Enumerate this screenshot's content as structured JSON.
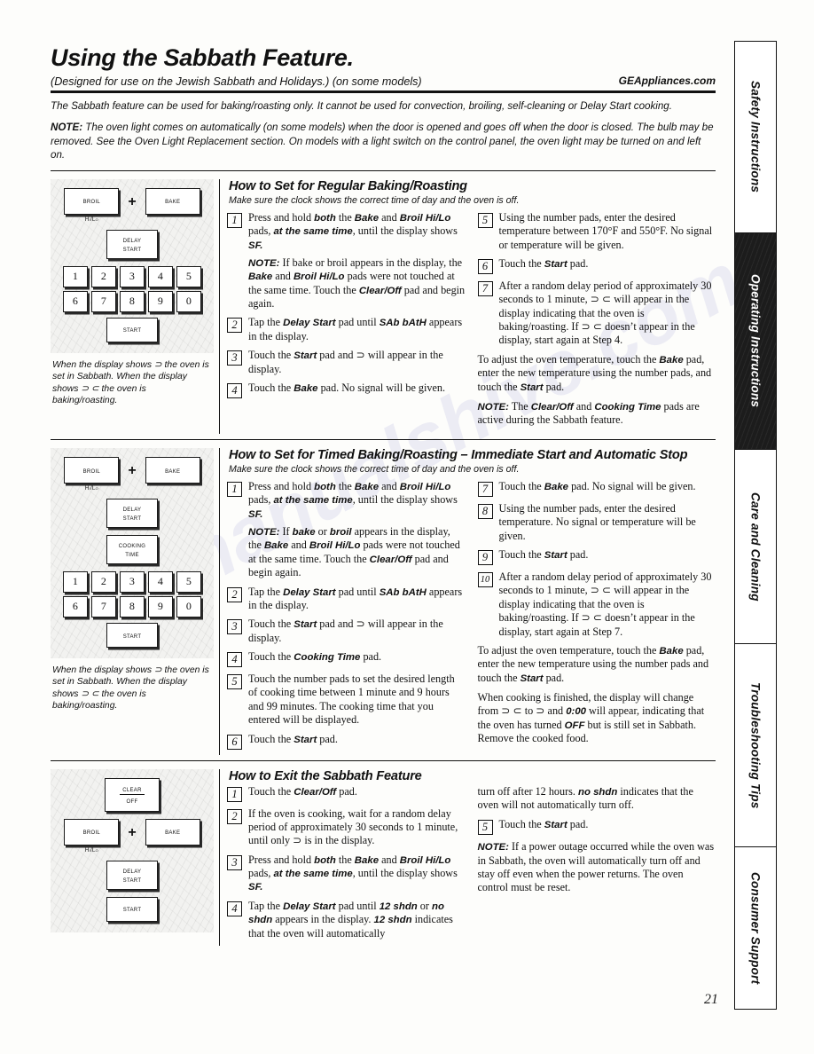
{
  "header": {
    "title": "Using the Sabbath Feature.",
    "subtitle": "(Designed for use on the Jewish Sabbath and Holidays.) (on some models)",
    "brand_url": "GEAppliances.com"
  },
  "intro": {
    "paragraph": "The Sabbath feature can be used for baking/roasting only. It cannot be used for convection, broiling, self-cleaning or Delay Start cooking.",
    "note_label": "NOTE:",
    "note_text": " The oven light comes on automatically (on some models) when the door is opened and goes off when the door is closed. The bulb may be removed. See the Oven Light Replacement section. On models with a light switch on the control panel, the oven light may be turned on and left on."
  },
  "panel_caption": "When the display shows ⊃ the oven is set in Sabbath. When the display shows ⊃ ⊂ the oven is baking/roasting.",
  "keys": {
    "broil": "Broil",
    "bake": "Bake",
    "hilo": "Hi/Lo",
    "delay_start_l1": "Delay",
    "delay_start_l2": "Start",
    "cooking_time_l1": "Cooking",
    "cooking_time_l2": "Time",
    "start": "Start",
    "clear_l1": "Clear",
    "clear_l2": "Off",
    "plus": "+",
    "numbers_row1": [
      "1",
      "2",
      "3",
      "4",
      "5"
    ],
    "numbers_row2": [
      "6",
      "7",
      "8",
      "9",
      "0"
    ]
  },
  "sections": [
    {
      "heading": "How to Set for Regular Baking/Roasting",
      "subheading": "Make sure the clock shows the correct time of day and the oven is off.",
      "steps_left": [
        {
          "num": "1",
          "paras": [
            "Press and hold <b class=\"sans\">both</b> the <b class=\"sans\">Bake</b> and <b class=\"sans\">Broil Hi/Lo</b> pads, <b class=\"sans\">at the same time</b>, until the display shows <b class=\"sans\">SF.</b>",
            "<b class=\"sans\">NOTE:</b> If bake or broil appears in the display, the <b class=\"sans\">Bake</b> and <b class=\"sans\">Broil Hi/Lo</b> pads were not touched at the same time. Touch the <b class=\"sans\">Clear/Off</b> pad and begin again."
          ]
        },
        {
          "num": "2",
          "paras": [
            "Tap the <b class=\"sans\">Delay Start</b> pad until <b class=\"sans\">SAb bAtH</b> appears in the display."
          ]
        },
        {
          "num": "3",
          "paras": [
            "Touch the <b class=\"sans\">Start</b> pad and ⊃ will appear in the display."
          ]
        },
        {
          "num": "4",
          "paras": [
            "Touch the <b class=\"sans\">Bake</b> pad. No signal will be given."
          ]
        }
      ],
      "steps_right": [
        {
          "num": "5",
          "paras": [
            "Using the number pads, enter the desired temperature between 170°F and 550°F. No signal or temperature will be given."
          ]
        },
        {
          "num": "6",
          "paras": [
            "Touch the <b class=\"sans\">Start</b> pad."
          ]
        },
        {
          "num": "7",
          "paras": [
            "After a random delay period of approximately 30 seconds to 1 minute, ⊃ ⊂ will appear in the display indicating that the oven is baking/roasting. If ⊃ ⊂ doesn’t appear in the display, start again at Step 4."
          ]
        }
      ],
      "closing_right": [
        "To adjust the oven temperature, touch the <b class=\"sans\">Bake</b> pad, enter the new temperature using the number pads, and touch the <b class=\"sans\">Start</b> pad.",
        "<b class=\"sans\">NOTE:</b> The <b class=\"sans\">Clear/Off</b> and <b class=\"sans\">Cooking Time</b> pads are active during the Sabbath feature."
      ]
    },
    {
      "heading": "How to Set for Timed Baking/Roasting – Immediate Start and Automatic Stop",
      "subheading": "Make sure the clock shows the correct time of day and the oven is off.",
      "steps_left": [
        {
          "num": "1",
          "paras": [
            "Press and hold <b class=\"sans\">both</b> the <b class=\"sans\">Bake</b> and <b class=\"sans\">Broil Hi/Lo</b> pads, <b class=\"sans\">at the same time</b>, until the display shows <b class=\"sans\">SF.</b>",
            "<b class=\"sans\">NOTE:</b> If <b class=\"sans\">bake</b> or <b class=\"sans\">broil</b> appears in the display, the <b class=\"sans\">Bake</b> and <b class=\"sans\">Broil Hi/Lo</b> pads were not touched at the same time. Touch the <b class=\"sans\">Clear/Off</b> pad and begin again."
          ]
        },
        {
          "num": "2",
          "paras": [
            "Tap the <b class=\"sans\">Delay Start</b> pad until <b class=\"sans\">SAb bAtH</b> appears in the display."
          ]
        },
        {
          "num": "3",
          "paras": [
            "Touch the <b class=\"sans\">Start</b> pad and ⊃ will appear in the display."
          ]
        },
        {
          "num": "4",
          "paras": [
            "Touch the <b class=\"sans\">Cooking Time</b> pad."
          ]
        },
        {
          "num": "5",
          "paras": [
            "Touch the number pads to set the desired length of cooking time between 1 minute and 9 hours and 99 minutes. The cooking time that you entered will be displayed."
          ]
        },
        {
          "num": "6",
          "paras": [
            "Touch the <b class=\"sans\">Start</b> pad."
          ]
        }
      ],
      "steps_right": [
        {
          "num": "7",
          "paras": [
            "Touch the <b class=\"sans\">Bake</b> pad. No signal will be given."
          ]
        },
        {
          "num": "8",
          "paras": [
            "Using the number pads, enter the desired temperature. No signal or temperature will be given."
          ]
        },
        {
          "num": "9",
          "paras": [
            "Touch the <b class=\"sans\">Start</b> pad."
          ]
        },
        {
          "num": "10",
          "paras": [
            "After a random delay period of approximately 30 seconds to 1 minute, ⊃ ⊂ will appear in the display indicating that the oven is baking/roasting. If ⊃ ⊂ doesn’t appear in the display, start again at Step 7."
          ]
        }
      ],
      "closing_right": [
        "To adjust the oven temperature, touch the <b class=\"sans\">Bake</b> pad, enter the new temperature using the number pads and touch the <b class=\"sans\">Start</b> pad.",
        "When cooking is finished, the display will change from ⊃ ⊂ to ⊃ and <b class=\"sans\">0:00</b> will appear, indicating that the oven has turned <b class=\"sans\">OFF</b> but is still set in Sabbath. Remove the cooked food."
      ]
    },
    {
      "heading": "How to Exit the Sabbath Feature",
      "subheading": "",
      "steps_left": [
        {
          "num": "1",
          "paras": [
            "Touch the <b class=\"sans\">Clear/Off</b> pad."
          ]
        },
        {
          "num": "2",
          "paras": [
            "If the oven is cooking, wait for a random delay period of approximately 30 seconds to 1 minute, until only ⊃ is in the display."
          ]
        },
        {
          "num": "3",
          "paras": [
            "Press and hold <b class=\"sans\">both</b> the <b class=\"sans\">Bake</b> and <b class=\"sans\">Broil Hi/Lo</b> pads, <b class=\"sans\">at the same time</b>, until the display shows <b class=\"sans\">SF.</b>"
          ]
        },
        {
          "num": "4",
          "paras": [
            "Tap the <b class=\"sans\">Delay Start</b> pad until <b class=\"sans\">12 shdn</b> or <b class=\"sans\">no shdn</b> appears in the display. <b class=\"sans\">12 shdn</b> indicates that the oven will automatically"
          ]
        }
      ],
      "steps_right": [
        {
          "num": "5",
          "paras": [
            "Touch the <b class=\"sans\">Start</b> pad."
          ]
        }
      ],
      "continuation_right": "turn off after 12 hours. <b class=\"sans\">no shdn</b> indicates that the oven will not automatically turn off.",
      "closing_right": [
        "<b class=\"sans\">NOTE:</b> If a power outage occurred while the oven was in Sabbath, the oven will automatically turn off and stay off even when the power returns. The oven control must be reset."
      ]
    }
  ],
  "tabs": [
    {
      "label": "Safety Instructions",
      "active": false
    },
    {
      "label": "Operating Instructions",
      "active": true
    },
    {
      "label": "Care and Cleaning",
      "active": false
    },
    {
      "label": "Troubleshooting Tips",
      "active": false
    },
    {
      "label": "Consumer Support",
      "active": false
    }
  ],
  "page_number": "21",
  "watermark": "manualshive.com"
}
